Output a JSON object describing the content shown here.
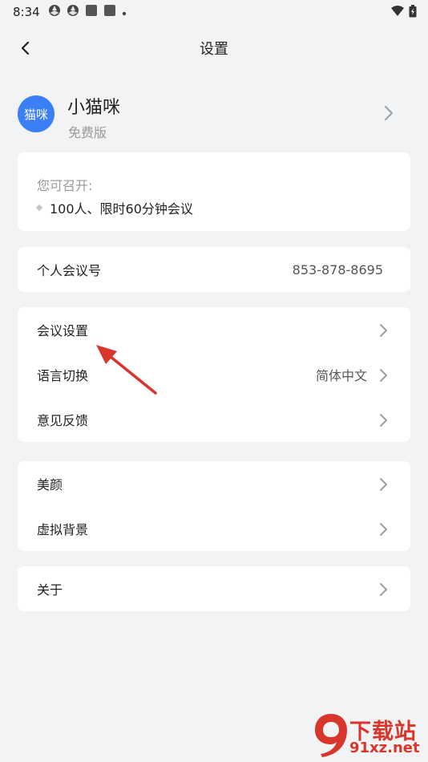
{
  "status_bar": {
    "time": "8:34",
    "icons": [
      "aperture-icon",
      "aperture-icon",
      "square-notification-icon",
      "square-notification-icon",
      "dot-icon"
    ],
    "right_icons": [
      "wifi-icon",
      "battery-icon"
    ]
  },
  "header": {
    "title": "设置",
    "back_icon": "chevron-left-icon"
  },
  "profile": {
    "avatar_text": "猫咪",
    "name": "小猫咪",
    "plan": "免费版",
    "avatar_color": "#3a7ff6"
  },
  "capabilities": {
    "caption": "您可召开:",
    "items": [
      "100人、限时60分钟会议"
    ]
  },
  "personal_meeting": {
    "label": "个人会议号",
    "value": "853-878-8695"
  },
  "settings_group": {
    "items": [
      {
        "label": "会议设置",
        "value": ""
      },
      {
        "label": "语言切换",
        "value": "简体中文"
      },
      {
        "label": "意见反馈",
        "value": ""
      }
    ]
  },
  "beauty_group": {
    "items": [
      {
        "label": "美颜"
      },
      {
        "label": "虚拟背景"
      }
    ]
  },
  "about_group": {
    "items": [
      {
        "label": "关于"
      }
    ]
  },
  "watermark": {
    "text": "下载站",
    "url": "91xz.net",
    "logo_glyph": "9",
    "color": "#d9362b"
  },
  "colors": {
    "background": "#f2f3f5",
    "card": "#ffffff",
    "annotation_arrow": "#d9362b"
  }
}
